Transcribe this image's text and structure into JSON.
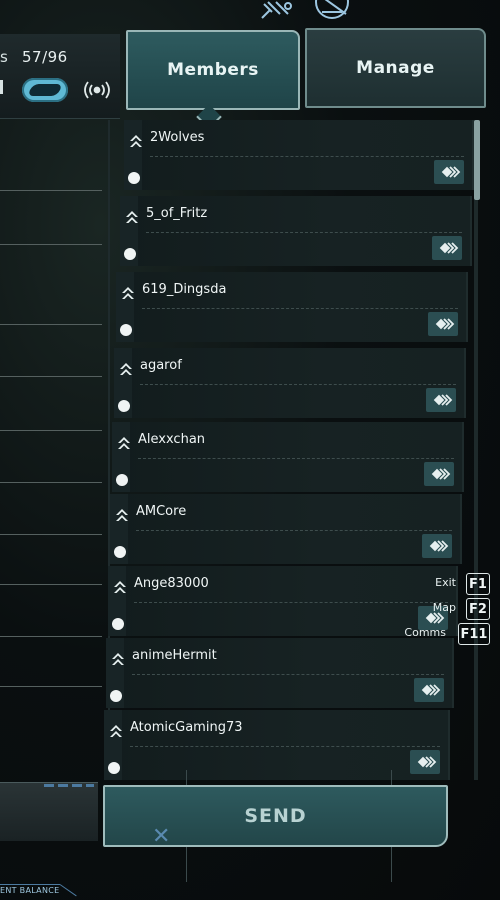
{
  "status": {
    "prefix": "s",
    "member_count": "57/96",
    "toggle_state": "on"
  },
  "tabs": [
    {
      "label": "Members",
      "active": true
    },
    {
      "label": "Manage",
      "active": false
    }
  ],
  "members": [
    {
      "name": "2Wolves",
      "status": "online"
    },
    {
      "name": "5_of_Fritz",
      "status": "online"
    },
    {
      "name": "619_Dingsda",
      "status": "online"
    },
    {
      "name": "agarof",
      "status": "online"
    },
    {
      "name": "Alexxchan",
      "status": "online"
    },
    {
      "name": "AMCore",
      "status": "online"
    },
    {
      "name": "Ange83000",
      "status": "online"
    },
    {
      "name": "animeHermit",
      "status": "online"
    },
    {
      "name": "AtomicGaming73",
      "status": "online"
    }
  ],
  "hotkeys": [
    {
      "label": "Exit",
      "key": "F1"
    },
    {
      "label": "Map",
      "key": "F2"
    },
    {
      "label": "Comms",
      "key": "F11"
    }
  ],
  "send": {
    "label": "SEND"
  },
  "footer": {
    "balance_label": "ENT BALANCE"
  },
  "colors": {
    "accent": "#2e5a5e",
    "border": "#9fbcbc",
    "toggle": "#5fb9d4",
    "background": "#0b1011"
  },
  "icons": {
    "top_left": "satellite-icon",
    "top_right": "globe-icon",
    "signal": "broadcast-icon",
    "rank": "rank-chevron-icon",
    "action": "member-action-icon"
  }
}
